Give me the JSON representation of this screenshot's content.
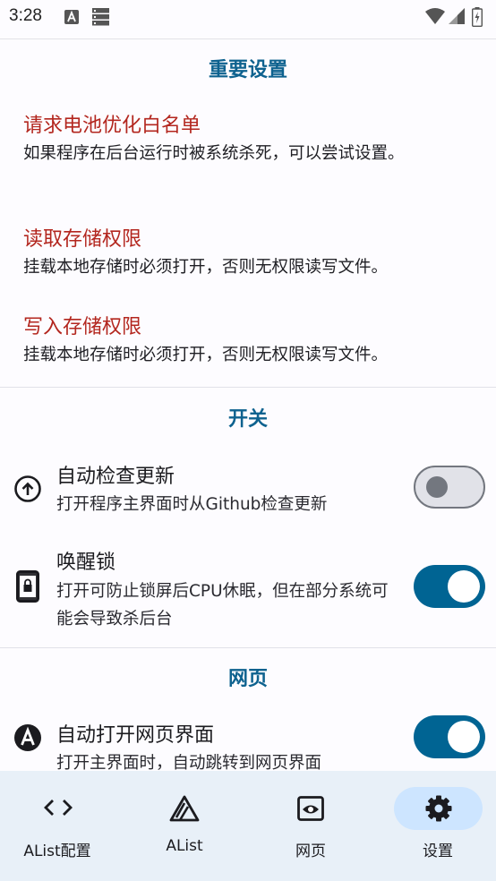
{
  "status_bar": {
    "time": "3:28",
    "left_icons": [
      "a-notification-icon",
      "storage-icon"
    ],
    "right_icons": [
      "wifi-icon",
      "signal-icon",
      "battery-icon"
    ]
  },
  "sections": {
    "important": {
      "title": "重要设置",
      "items": [
        {
          "title": "请求电池优化白名单",
          "desc": "如果程序在后台运行时被系统杀死，可以尝试设置。"
        },
        {
          "title": "读取存储权限",
          "desc": "挂载本地存储时必须打开，否则无权限读写文件。"
        },
        {
          "title": "写入存储权限",
          "desc": "挂载本地存储时必须打开，否则无权限读写文件。"
        }
      ]
    },
    "switches": {
      "title": "开关",
      "items": [
        {
          "icon": "upload-circle-icon",
          "title": "自动检查更新",
          "desc": "打开程序主界面时从Github检查更新",
          "enabled": false
        },
        {
          "icon": "lock-phone-icon",
          "title": "唤醒锁",
          "desc": "打开可防止锁屏后CPU休眠，但在部分系统可能会导致杀后台",
          "enabled": true
        }
      ]
    },
    "web": {
      "title": "网页",
      "items": [
        {
          "icon": "a-circle-icon",
          "title": "自动打开网页界面",
          "desc": "打开主界面时，自动跳转到网页界面",
          "enabled": true
        }
      ]
    }
  },
  "bottom_nav": {
    "items": [
      {
        "icon": "code-icon",
        "label": "AList配置",
        "selected": false
      },
      {
        "icon": "alist-logo-icon",
        "label": "AList",
        "selected": false
      },
      {
        "icon": "web-icon",
        "label": "网页",
        "selected": false
      },
      {
        "icon": "settings-icon",
        "label": "设置",
        "selected": true
      }
    ]
  },
  "colors": {
    "accent": "#006493",
    "section_title": "#0e628f",
    "warning_title": "#b3261e",
    "nav_bg": "#e8f0f8",
    "nav_selected": "#cde5ff"
  }
}
